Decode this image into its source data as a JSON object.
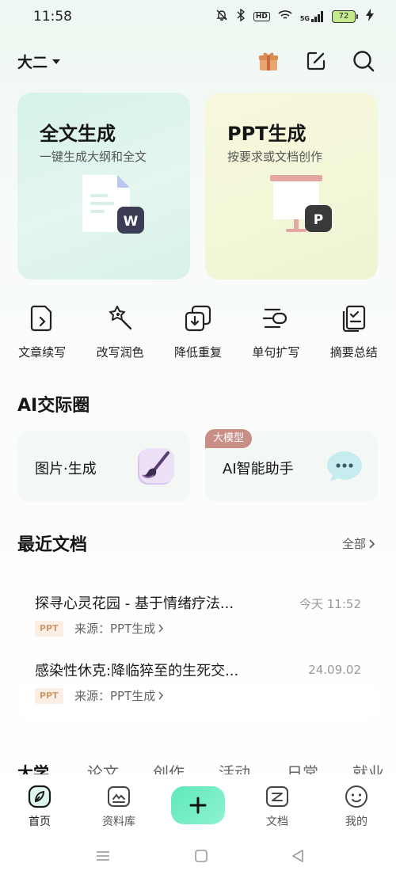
{
  "status_bar": {
    "time": "11:58",
    "network": "5G",
    "hd": "HD",
    "battery": "72"
  },
  "header": {
    "grade": "大二",
    "icons": [
      "gift-icon",
      "edit-icon",
      "search-icon"
    ]
  },
  "feature_cards": [
    {
      "title": "全文生成",
      "subtitle": "一键生成大纲和全文",
      "badge": "W",
      "accent": "#3a3d54"
    },
    {
      "title": "PPT生成",
      "subtitle": "按要求或文档创作",
      "badge": "P",
      "accent": "#3a3a3a"
    }
  ],
  "tools": [
    {
      "label": "文章续写",
      "icon": "doc-continue-icon"
    },
    {
      "label": "改写润色",
      "icon": "polish-wand-icon"
    },
    {
      "label": "降低重复",
      "icon": "reduce-duplicate-icon"
    },
    {
      "label": "单句扩写",
      "icon": "sentence-expand-icon"
    },
    {
      "label": "摘要总结",
      "icon": "summary-icon"
    }
  ],
  "ai_circle": {
    "title": "AI交际圈",
    "cards": [
      {
        "label": "图片·生成",
        "icon": "paintbrush-icon"
      },
      {
        "label": "AI智能助手",
        "badge": "大模型",
        "icon": "chat-bubble-icon"
      }
    ]
  },
  "recent_docs": {
    "title": "最近文档",
    "see_all": "全部",
    "items": [
      {
        "title": "探寻心灵花园 - 基于情绪疗法...",
        "time": "今天 11:52",
        "tag": "PPT",
        "source": "来源：PPT生成"
      },
      {
        "title": "感染性休克:降临猝至的生死交...",
        "time": "24.09.02",
        "tag": "PPT",
        "source": "来源：PPT生成"
      }
    ]
  },
  "category_tabs": [
    "大学",
    "论文",
    "创作",
    "活动",
    "日常",
    "就业"
  ],
  "bottom_nav": [
    {
      "label": "首页",
      "icon": "home-leaf-icon",
      "active": true
    },
    {
      "label": "资料库",
      "icon": "library-icon",
      "active": false
    },
    {
      "label": "",
      "icon": "plus-icon",
      "active": false
    },
    {
      "label": "文档",
      "icon": "docs-icon",
      "active": false
    },
    {
      "label": "我的",
      "icon": "profile-face-icon",
      "active": false
    }
  ],
  "colors": {
    "create_button": "#6aedbf",
    "ppt_tag_bg": "#fbeee4",
    "ppt_tag_text": "#d09a6c",
    "badge_bg": "#c98e86"
  }
}
